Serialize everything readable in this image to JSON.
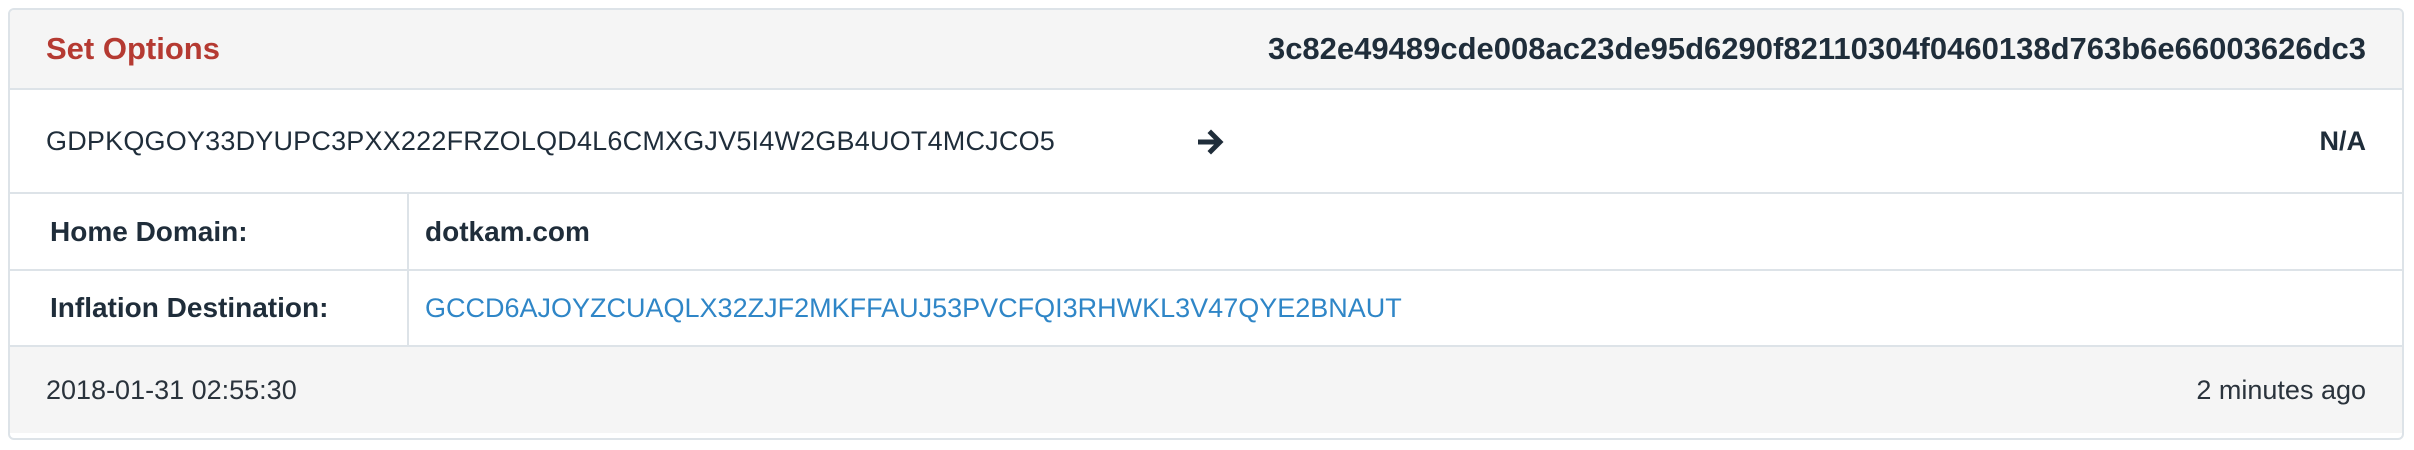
{
  "operation": {
    "title": "Set Options",
    "transaction_hash": "3c82e49489cde008ac23de95d6290f82110304f0460138d763b6e66003626dc3"
  },
  "account_row": {
    "source_account": "GDPKQGOY33DYUPC3PXX222FRZOLQD4L6CMXGJV5I4W2GB4UOT4MCJCO5",
    "arrow_icon": "arrow-right-icon",
    "target": "N/A"
  },
  "details": [
    {
      "label": "Home Domain:",
      "value": "dotkam.com"
    },
    {
      "label": "Inflation Destination:",
      "value": "GCCD6AJOYZCUAQLX32ZJF2MKFFAUJ53PVCFQI3RHWKL3V47QYE2BNAUT"
    }
  ],
  "footer": {
    "timestamp": "2018-01-31 02:55:30",
    "relative_time": "2 minutes ago"
  },
  "colors": {
    "title_red": "#b53a32",
    "link_blue": "#2f86c7",
    "text_dark": "#1f2d3a",
    "header_bg": "#f5f5f5",
    "border": "#dde3e8"
  }
}
